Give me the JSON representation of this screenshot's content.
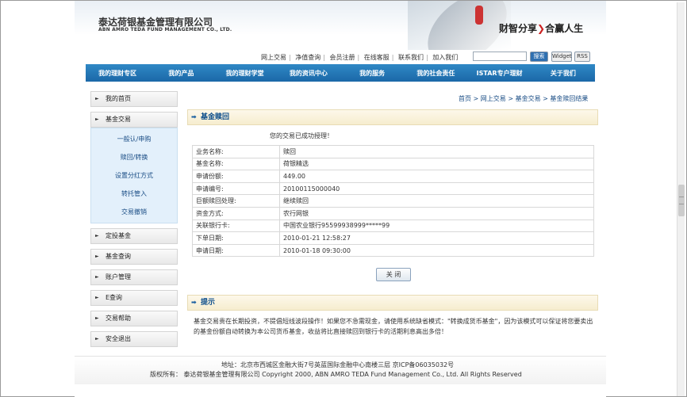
{
  "header": {
    "logo_cn": "泰达荷银基金管理有限公司",
    "logo_en": "ABN AMRO TEDA FUND MANAGEMENT CO., LTD.",
    "slogan_left": "财智分享",
    "slogan_arrow": "❯",
    "slogan_right": "合赢人生"
  },
  "toplinks": [
    "网上交易",
    "净值查询",
    "会员注册",
    "在线客服",
    "联系我们",
    "加入我们"
  ],
  "search": {
    "button": "搜索",
    "widget": "Widget",
    "rss": "RSS"
  },
  "nav": [
    "我的理财专区",
    "我的产品",
    "我的理财学堂",
    "我的资讯中心",
    "我的服务",
    "我的社会责任",
    "ISTAR专户理财",
    "关于我们"
  ],
  "sidebar": {
    "home": "我的首页",
    "trade": "基金交易",
    "submenu": [
      "一般认/申购",
      "赎回/转换",
      "设置分红方式",
      "转托管入",
      "交易撤销"
    ],
    "items": [
      "定投基金",
      "基金查询",
      "账户管理",
      "E查询",
      "交易帮助",
      "安全退出"
    ]
  },
  "breadcrumb": "首页 > 网上交易 > 基金交易 > 基金赎回结果",
  "section_title": "基金赎回",
  "success_msg": "您的交易已成功授理！",
  "table": [
    {
      "k": "业务名称:",
      "v": "赎回"
    },
    {
      "k": "基金名称:",
      "v": "荷银精选"
    },
    {
      "k": "申请份额:",
      "v": "449.00"
    },
    {
      "k": "申请编号:",
      "v": "20100115000040"
    },
    {
      "k": "巨额赎回处理:",
      "v": "继续赎回"
    },
    {
      "k": "资金方式:",
      "v": "农行网银"
    },
    {
      "k": "关联银行卡:",
      "v": "中国农业银行95599938999*****99"
    },
    {
      "k": "下单日期:",
      "v": "2010-01-21 12:58:27"
    },
    {
      "k": "申请日期:",
      "v": "2010-01-18 09:30:00"
    }
  ],
  "close_label": "关 闭",
  "tip_title": "提示",
  "tip_text": "基金交易贵在长期投资，不提倡短线波段操作！如果您不急需现金，请使用系统缺省模式：\"转换成货币基金\"，因为该模式可以保证将您要卖出的基金份额自动转换为本公司货币基金，收益将比直接赎回到银行卡的活期利息高出多倍！",
  "footer": {
    "address": "地址：北京市西城区金融大街7号英蓝国际金融中心南楼三层 京ICP备06035032号",
    "copyright": "版权所有：  泰达荷银基金管理有限公司  Copyright 2000, ABN AMRO TEDA Fund Management Co., Ltd. All Rights Reserved"
  }
}
